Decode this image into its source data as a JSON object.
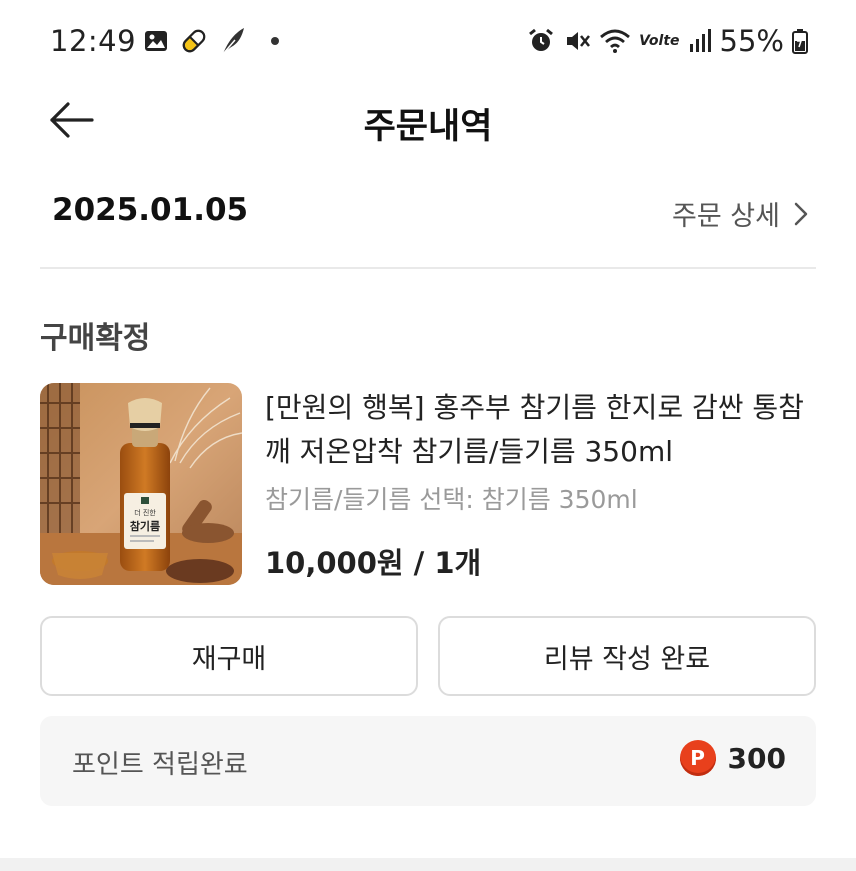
{
  "status_bar": {
    "time": "12:49",
    "battery": "55%",
    "icons_left": [
      "gallery-icon",
      "pill-icon",
      "feather-icon"
    ],
    "icons_right": [
      "alarm-icon",
      "mute-icon",
      "wifi-icon",
      "volte-icon",
      "signal-icon",
      "battery-icon"
    ],
    "volte_text": "Volte"
  },
  "app_bar": {
    "title": "주문내역",
    "back_icon": "arrow-left-icon"
  },
  "order": {
    "date": "2025.01.05",
    "detail_link": "주문 상세",
    "status": "구매확정",
    "product": {
      "name": "[만원의 행복] 홍주부 참기름 한지로 감싼 통참깨 저온압착 참기름/들기름 350ml",
      "option": "참기름/들기름 선택: 참기름 350ml",
      "price": "10,000원 / 1개",
      "thumb_label_small": "더 진한",
      "thumb_label_big": "참기름"
    },
    "buttons": {
      "rebuy": "재구매",
      "review": "리뷰 작성 완료"
    },
    "points": {
      "label": "포인트 적립완료",
      "badge": "P",
      "value": "300"
    }
  },
  "colors": {
    "point_badge": "#e8401c",
    "divider": "#e9e9e9",
    "points_bg": "#f6f6f6"
  }
}
